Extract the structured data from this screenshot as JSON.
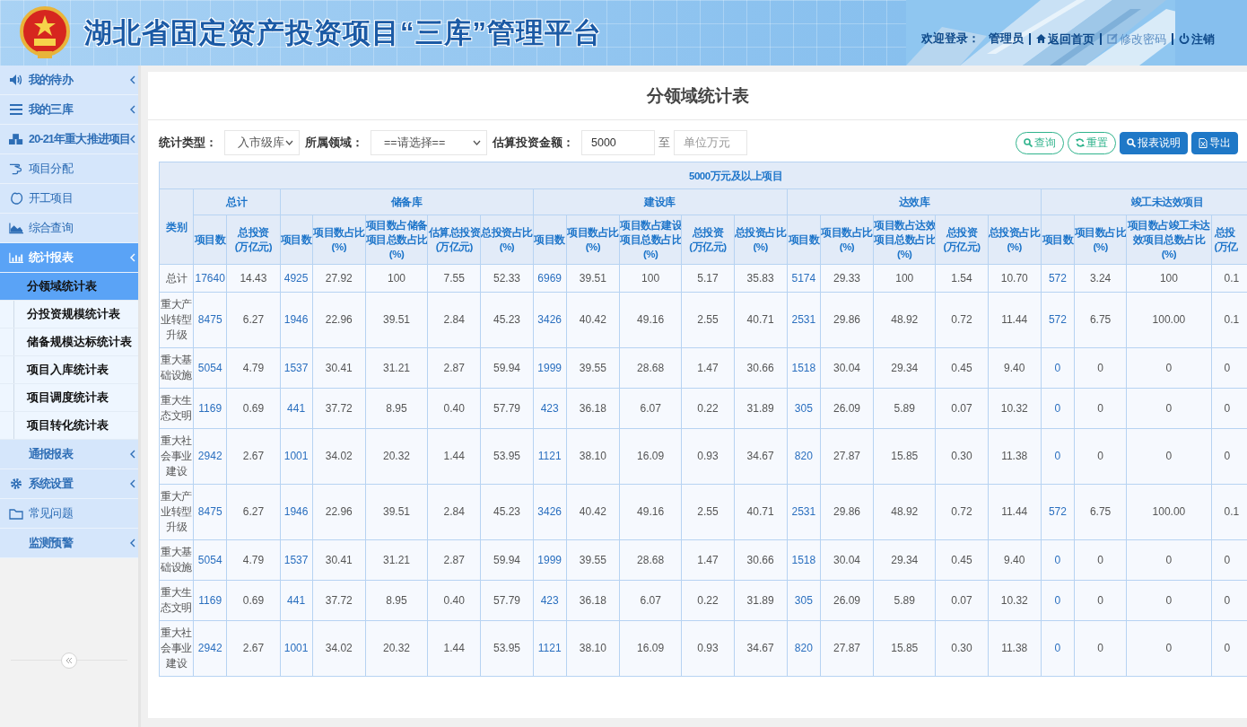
{
  "header": {
    "title": "湖北省固定资产投资项目“三库”管理平台",
    "welcome": "欢迎登录：",
    "user": "管理员",
    "links": [
      {
        "label": "返回首页",
        "kind": "home"
      },
      {
        "label": "修改密码",
        "kind": "edit"
      },
      {
        "label": "注销",
        "kind": "logout"
      }
    ]
  },
  "sidebar": {
    "items": [
      {
        "label": "我的待办",
        "submenu": true,
        "selected": false
      },
      {
        "label": "我的三库",
        "submenu": true,
        "selected": false
      },
      {
        "label": "20-21年重大推进项目",
        "submenu": true,
        "selected": false
      },
      {
        "label": "项目分配",
        "submenu": false,
        "selected": false
      },
      {
        "label": "开工项目",
        "submenu": false,
        "selected": false
      },
      {
        "label": "综合查询",
        "submenu": false,
        "selected": false
      },
      {
        "label": "统计报表",
        "submenu": true,
        "selected": true,
        "children": [
          {
            "label": "分领域统计表",
            "selected": true
          },
          {
            "label": "分投资规模统计表",
            "selected": false
          },
          {
            "label": "储备规模达标统计表",
            "selected": false
          },
          {
            "label": "项目入库统计表",
            "selected": false
          },
          {
            "label": "项目调度统计表",
            "selected": false
          },
          {
            "label": "项目转化统计表",
            "selected": false
          }
        ]
      },
      {
        "label": "通报报表",
        "submenu": true,
        "selected": false
      },
      {
        "label": "系统设置",
        "submenu": true,
        "selected": false
      },
      {
        "label": "常见问题",
        "submenu": false,
        "selected": false
      },
      {
        "label": "监测预警",
        "submenu": true,
        "selected": false
      }
    ]
  },
  "page_title": "分领域统计表",
  "filters": [
    {
      "kind": "select",
      "label": "统计类型：",
      "value": "入市级库"
    },
    {
      "kind": "select",
      "label": "所属领域：",
      "value": "==请选择=="
    },
    {
      "kind": "range",
      "label": "估算投资金额：",
      "value": "5000",
      "separator": "至",
      "placeholder": "单位万元"
    }
  ],
  "buttons": [
    {
      "label": "查询",
      "kind": "outline"
    },
    {
      "label": "重置",
      "kind": "outline"
    },
    {
      "label": "报表说明",
      "kind": "solid"
    },
    {
      "label": "导出",
      "kind": "solid"
    }
  ],
  "table": {
    "title": "5000万元及以上项目",
    "row_header": "类别",
    "groups": [
      {
        "label": "总计",
        "columns": [
          {
            "lines": [
              "项目数"
            ],
            "kind": "count"
          },
          {
            "lines": [
              "总投资",
              "(万亿元)"
            ],
            "kind": "value"
          }
        ]
      },
      {
        "label": "储备库",
        "columns": [
          {
            "lines": [
              "项目数"
            ],
            "kind": "count"
          },
          {
            "lines": [
              "项目数占比",
              "(%)"
            ],
            "kind": "value"
          },
          {
            "lines": [
              "项目数占储备",
              "项目总数占比",
              "(%)"
            ],
            "kind": "value"
          },
          {
            "lines": [
              "估算总投资",
              "(万亿元)"
            ],
            "kind": "value"
          },
          {
            "lines": [
              "总投资占比",
              "(%)"
            ],
            "kind": "value"
          }
        ]
      },
      {
        "label": "建设库",
        "columns": [
          {
            "lines": [
              "项目数"
            ],
            "kind": "count"
          },
          {
            "lines": [
              "项目数占比",
              "(%)"
            ],
            "kind": "value"
          },
          {
            "lines": [
              "项目数占建设",
              "项目总数占比",
              "(%)"
            ],
            "kind": "value"
          },
          {
            "lines": [
              "总投资",
              "(万亿元)"
            ],
            "kind": "value"
          },
          {
            "lines": [
              "总投资占比",
              "(%)"
            ],
            "kind": "value"
          }
        ]
      },
      {
        "label": "达效库",
        "columns": [
          {
            "lines": [
              "项目数"
            ],
            "kind": "count"
          },
          {
            "lines": [
              "项目数占比",
              "(%)"
            ],
            "kind": "value"
          },
          {
            "lines": [
              "项目数占达效",
              "项目总数占比",
              "(%)"
            ],
            "kind": "value"
          },
          {
            "lines": [
              "总投资",
              "(万亿元)"
            ],
            "kind": "value"
          },
          {
            "lines": [
              "总投资占比",
              "(%)"
            ],
            "kind": "value"
          }
        ]
      },
      {
        "label": "竣工未达效项目",
        "columns": [
          {
            "lines": [
              "项目数"
            ],
            "kind": "count"
          },
          {
            "lines": [
              "项目数占比",
              "(%)"
            ],
            "kind": "value"
          },
          {
            "lines": [
              "项目数占竣工未达",
              "效项目总数占比",
              "(%)"
            ],
            "kind": "value"
          },
          {
            "lines": [
              "总投",
              "(万亿"
            ],
            "kind": "value"
          }
        ]
      }
    ],
    "rows": [
      {
        "category": "总计",
        "cells": [
          "17640",
          "14.43",
          "4925",
          "27.92",
          "100",
          "7.55",
          "52.33",
          "6969",
          "39.51",
          "100",
          "5.17",
          "35.83",
          "5174",
          "29.33",
          "100",
          "1.54",
          "10.70",
          "572",
          "3.24",
          "100",
          "0.1"
        ]
      },
      {
        "category": "重大产业转型升级",
        "cells": [
          "8475",
          "6.27",
          "1946",
          "22.96",
          "39.51",
          "2.84",
          "45.23",
          "3426",
          "40.42",
          "49.16",
          "2.55",
          "40.71",
          "2531",
          "29.86",
          "48.92",
          "0.72",
          "11.44",
          "572",
          "6.75",
          "100.00",
          "0.1"
        ]
      },
      {
        "category": "重大基础设施",
        "cells": [
          "5054",
          "4.79",
          "1537",
          "30.41",
          "31.21",
          "2.87",
          "59.94",
          "1999",
          "39.55",
          "28.68",
          "1.47",
          "30.66",
          "1518",
          "30.04",
          "29.34",
          "0.45",
          "9.40",
          "0",
          "0",
          "0",
          "0"
        ]
      },
      {
        "category": "重大生态文明",
        "cells": [
          "1169",
          "0.69",
          "441",
          "37.72",
          "8.95",
          "0.40",
          "57.79",
          "423",
          "36.18",
          "6.07",
          "0.22",
          "31.89",
          "305",
          "26.09",
          "5.89",
          "0.07",
          "10.32",
          "0",
          "0",
          "0",
          "0"
        ]
      },
      {
        "category": "重大社会事业建设",
        "cells": [
          "2942",
          "2.67",
          "1001",
          "34.02",
          "20.32",
          "1.44",
          "53.95",
          "1121",
          "38.10",
          "16.09",
          "0.93",
          "34.67",
          "820",
          "27.87",
          "15.85",
          "0.30",
          "11.38",
          "0",
          "0",
          "0",
          "0"
        ]
      },
      {
        "category": "重大产业转型升级",
        "cells": [
          "8475",
          "6.27",
          "1946",
          "22.96",
          "39.51",
          "2.84",
          "45.23",
          "3426",
          "40.42",
          "49.16",
          "2.55",
          "40.71",
          "2531",
          "29.86",
          "48.92",
          "0.72",
          "11.44",
          "572",
          "6.75",
          "100.00",
          "0.1"
        ]
      },
      {
        "category": "重大基础设施",
        "cells": [
          "5054",
          "4.79",
          "1537",
          "30.41",
          "31.21",
          "2.87",
          "59.94",
          "1999",
          "39.55",
          "28.68",
          "1.47",
          "30.66",
          "1518",
          "30.04",
          "29.34",
          "0.45",
          "9.40",
          "0",
          "0",
          "0",
          "0"
        ]
      },
      {
        "category": "重大生态文明",
        "cells": [
          "1169",
          "0.69",
          "441",
          "37.72",
          "8.95",
          "0.40",
          "57.79",
          "423",
          "36.18",
          "6.07",
          "0.22",
          "31.89",
          "305",
          "26.09",
          "5.89",
          "0.07",
          "10.32",
          "0",
          "0",
          "0",
          "0"
        ]
      },
      {
        "category": "重大社会事业建设",
        "cells": [
          "2942",
          "2.67",
          "1001",
          "34.02",
          "20.32",
          "1.44",
          "53.95",
          "1121",
          "38.10",
          "16.09",
          "0.93",
          "34.67",
          "820",
          "27.87",
          "15.85",
          "0.30",
          "11.38",
          "0",
          "0",
          "0",
          "0"
        ]
      }
    ]
  }
}
